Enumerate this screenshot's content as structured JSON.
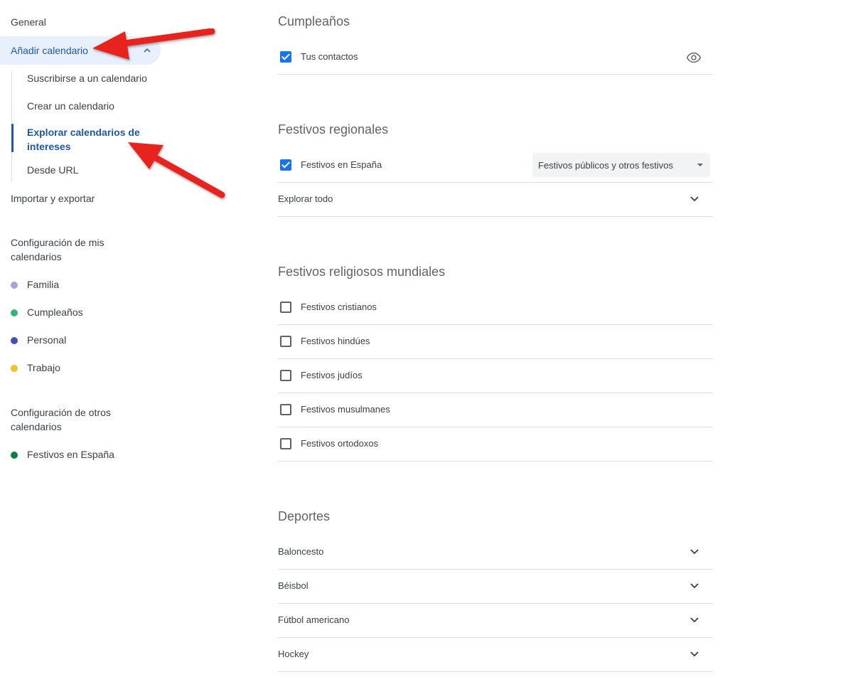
{
  "sidebar": {
    "general": "General",
    "add_calendar": "Añadir calendario",
    "sub_items": [
      "Suscribirse a un calendario",
      "Crear un calendario",
      "Explorar calendarios de intereses",
      "Desde URL"
    ],
    "import_export": "Importar y exportar",
    "my_calendars_heading": "Configuración de mis calendarios",
    "my_calendars": [
      {
        "name": "Familia",
        "color": "#b39ddb"
      },
      {
        "name": "Cumpleaños",
        "color": "#33b679"
      },
      {
        "name": "Personal",
        "color": "#3f51b5"
      },
      {
        "name": "Trabajo",
        "color": "#f6bf26"
      }
    ],
    "other_calendars_heading": "Configuración de otros calendarios",
    "other_calendars": [
      {
        "name": "Festivos en España",
        "color": "#0b8043"
      }
    ]
  },
  "main": {
    "birthdays": {
      "title": "Cumpleaños",
      "item": "Tus contactos",
      "checked": true
    },
    "regional": {
      "title": "Festivos regionales",
      "item": "Festivos en España",
      "checked": true,
      "select_value": "Festivos públicos y otros festivos",
      "explore": "Explorar todo"
    },
    "religious": {
      "title": "Festivos religiosos mundiales",
      "items": [
        "Festivos cristianos",
        "Festivos hindúes",
        "Festivos judíos",
        "Festivos musulmanes",
        "Festivos ortodoxos"
      ]
    },
    "sports": {
      "title": "Deportes",
      "items": [
        "Baloncesto",
        "Béisbol",
        "Fútbol americano",
        "Hockey"
      ]
    }
  },
  "colors": {
    "accent": "#1a57b5",
    "checkbox": "#1a73e8",
    "arrow": "#e8201c"
  }
}
